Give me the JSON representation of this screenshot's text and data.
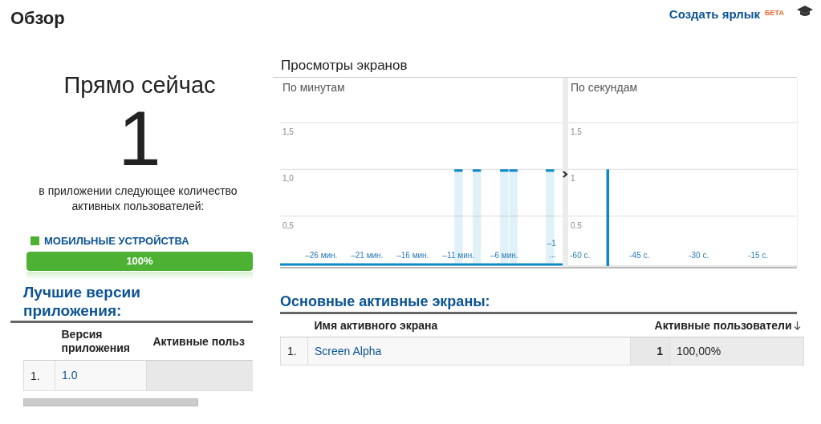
{
  "header": {
    "title": "Обзор",
    "shortcut_link": "Создать ярлык",
    "shortcut_badge": "БЕТА"
  },
  "realtime": {
    "title": "Прямо сейчас",
    "count": "1",
    "description": "в приложении следующее количество активных пользователей:"
  },
  "devices": [
    {
      "label": "МОБИЛЬНЫЕ УСТРОЙСТВА",
      "color": "#4db234",
      "level": 1,
      "reading": "100%"
    }
  ],
  "top_versions": {
    "title": "Лучшие версии приложения:",
    "columns": [
      "Версия приложения",
      "Активные польз"
    ],
    "rows": [
      {
        "index": "1.",
        "version": "1.0"
      }
    ]
  },
  "screen_views": {
    "title": "Просмотры экранов",
    "panels": [
      {
        "subtitle": "По минутам",
        "kind": "highlight",
        "chart_data": {
          "type": "bar",
          "x": [
            -30,
            -29,
            -28,
            -27,
            -26,
            -25,
            -24,
            -23,
            -22,
            -21,
            -20,
            -19,
            -18,
            -17,
            -16,
            -15,
            -14,
            -13,
            -12,
            -11,
            -10,
            -9,
            -8,
            -7,
            -6,
            -5,
            -4,
            -3,
            -2,
            -1
          ],
          "series": [
            {
              "color": "#0a88c8",
              "values": [
                0,
                0,
                0,
                0,
                0,
                0,
                0,
                0,
                0,
                0,
                0,
                0,
                0,
                0,
                0,
                0,
                0,
                0,
                0,
                1,
                0,
                1,
                0,
                0,
                1,
                1,
                0,
                0,
                0,
                1
              ]
            }
          ],
          "xlim": [
            -30.5,
            -0.5
          ],
          "ylim": [
            0,
            1.5
          ],
          "yticks": [
            {
              "value": 0.5,
              "label": "0,5"
            },
            {
              "value": 1,
              "label": "1,0"
            },
            {
              "value": 1.5,
              "label": "1,5"
            }
          ],
          "xticks": [
            {
              "value": -26,
              "label": "–26 мин."
            },
            {
              "value": -21,
              "label": "–21 мин."
            },
            {
              "value": -16,
              "label": "–16 мин."
            },
            {
              "value": -11,
              "label": "–11 мин."
            },
            {
              "value": -6,
              "label": "–6 мин."
            },
            {
              "value": -1,
              "label": "–1 ..."
            }
          ]
        }
      },
      {
        "subtitle": "По секундам",
        "kind": "solid",
        "chart_data": {
          "type": "bar",
          "x": [
            -60,
            -59,
            -58,
            -57,
            -56,
            -55,
            -54,
            -53,
            -52,
            -51,
            -50,
            -49,
            -48,
            -47,
            -46,
            -45,
            -44,
            -43,
            -42,
            -41,
            -40,
            -39,
            -38,
            -37,
            -36,
            -35,
            -34,
            -33,
            -32,
            -31,
            -30,
            -29,
            -28,
            -27,
            -26,
            -25,
            -24,
            -23,
            -22,
            -21,
            -20,
            -19,
            -18,
            -17,
            -16,
            -15,
            -14,
            -13,
            -12,
            -11,
            -10,
            -9,
            -8,
            -7,
            -6
          ],
          "series": [
            {
              "color": "#0a88c8",
              "values": [
                0,
                0,
                0,
                0,
                0,
                0,
                0,
                1,
                0,
                0,
                0,
                0,
                0,
                0,
                0,
                0,
                0,
                0,
                0,
                0,
                0,
                0,
                0,
                0,
                0,
                0,
                0,
                0,
                0,
                0,
                0,
                0,
                0,
                0,
                0,
                0,
                0,
                0,
                0,
                0,
                0,
                0,
                0,
                0,
                0,
                0,
                0,
                0,
                0,
                0,
                0,
                0,
                0,
                0,
                0
              ]
            }
          ],
          "xlim": [
            -63,
            -5
          ],
          "ylim": [
            0,
            1.5
          ],
          "yticks": [
            {
              "value": 0.5,
              "label": "0.5"
            },
            {
              "value": 1,
              "label": "1"
            },
            {
              "value": 1.5,
              "label": "1.5"
            }
          ],
          "xticks": [
            {
              "value": -60,
              "label": "-60 с."
            },
            {
              "value": -45,
              "label": "-45 с."
            },
            {
              "value": -30,
              "label": "-30 с."
            },
            {
              "value": -15,
              "label": "-15 с."
            }
          ]
        }
      }
    ]
  },
  "top_screens": {
    "title": "Основные активные экраны:",
    "columns": [
      "Имя активного экрана",
      "Активные пользователи"
    ],
    "rows": [
      {
        "index": "1.",
        "screen": "Screen Alpha",
        "users": "1",
        "share": "100,00%"
      }
    ]
  }
}
